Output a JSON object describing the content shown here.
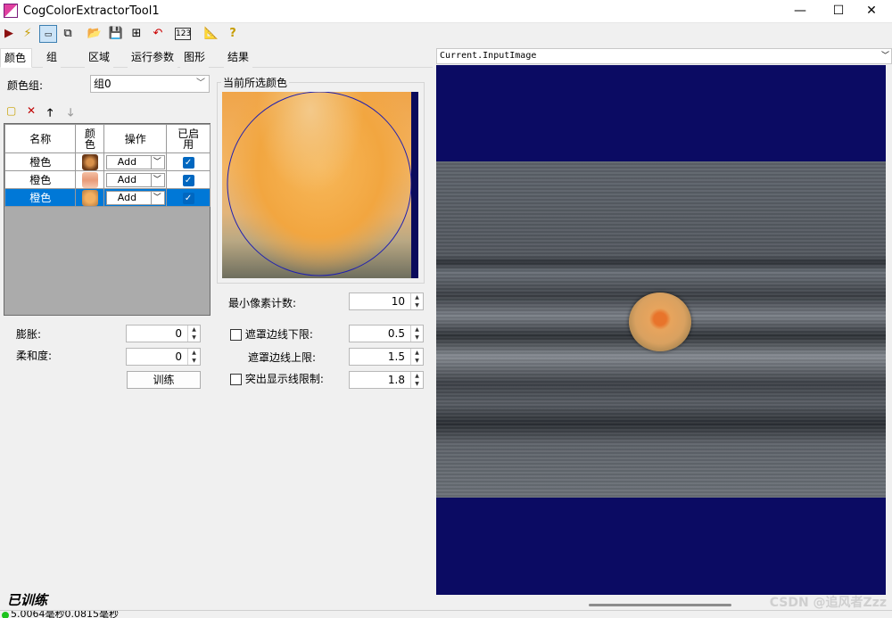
{
  "window": {
    "title": "CogColorExtractorTool1",
    "controls": {
      "minimize": "—",
      "maximize": "☐",
      "close": "✕"
    }
  },
  "toolbar": {
    "icons": [
      "run-icon",
      "flash-icon",
      "image-view-icon",
      "copy-icon",
      "open-icon",
      "save-icon",
      "network-icon",
      "reset-icon",
      "number-icon",
      "ruler-icon",
      "help-icon"
    ],
    "number_label": "123"
  },
  "tabs": [
    {
      "label": "颜色",
      "active": true
    },
    {
      "label": "组"
    },
    {
      "label": "区域"
    },
    {
      "label": "运行参数"
    },
    {
      "label": "图形"
    },
    {
      "label": "结果"
    }
  ],
  "color_group": {
    "label": "颜色组:",
    "value": "组0"
  },
  "grid": {
    "headers": {
      "name": "名称",
      "color": "颜\n色",
      "operation": "操作",
      "enabled": "已启\n用"
    },
    "rows": [
      {
        "name": "橙色",
        "operation": "Add",
        "enabled": true,
        "swatch": "#b56a30"
      },
      {
        "name": "橙色",
        "operation": "Add",
        "enabled": true,
        "swatch": "#f2b28c"
      },
      {
        "name": "橙色",
        "operation": "Add",
        "enabled": true,
        "swatch": "#e0a050",
        "selected": true
      }
    ]
  },
  "dilate": {
    "label": "膨胀:",
    "value": "0"
  },
  "softness": {
    "label": "柔和度:",
    "value": "0"
  },
  "train_button": "训练",
  "preview": {
    "title": "当前所选颜色"
  },
  "min_pixel": {
    "label": "最小像素计数:",
    "value": "10"
  },
  "mask_lower": {
    "label": "遮罩边线下限:",
    "value": "0.5"
  },
  "mask_upper": {
    "label": "遮罩边线上限:",
    "value": "1.5"
  },
  "highlight_limit": {
    "label": "突出显示线限制:",
    "value": "1.8"
  },
  "status": {
    "trained": "已训练",
    "timing": "5.0064毫秒0.0815毫秒"
  },
  "image": {
    "selector": "Current.InputImage"
  },
  "watermark": "CSDN @追风者Zzz"
}
